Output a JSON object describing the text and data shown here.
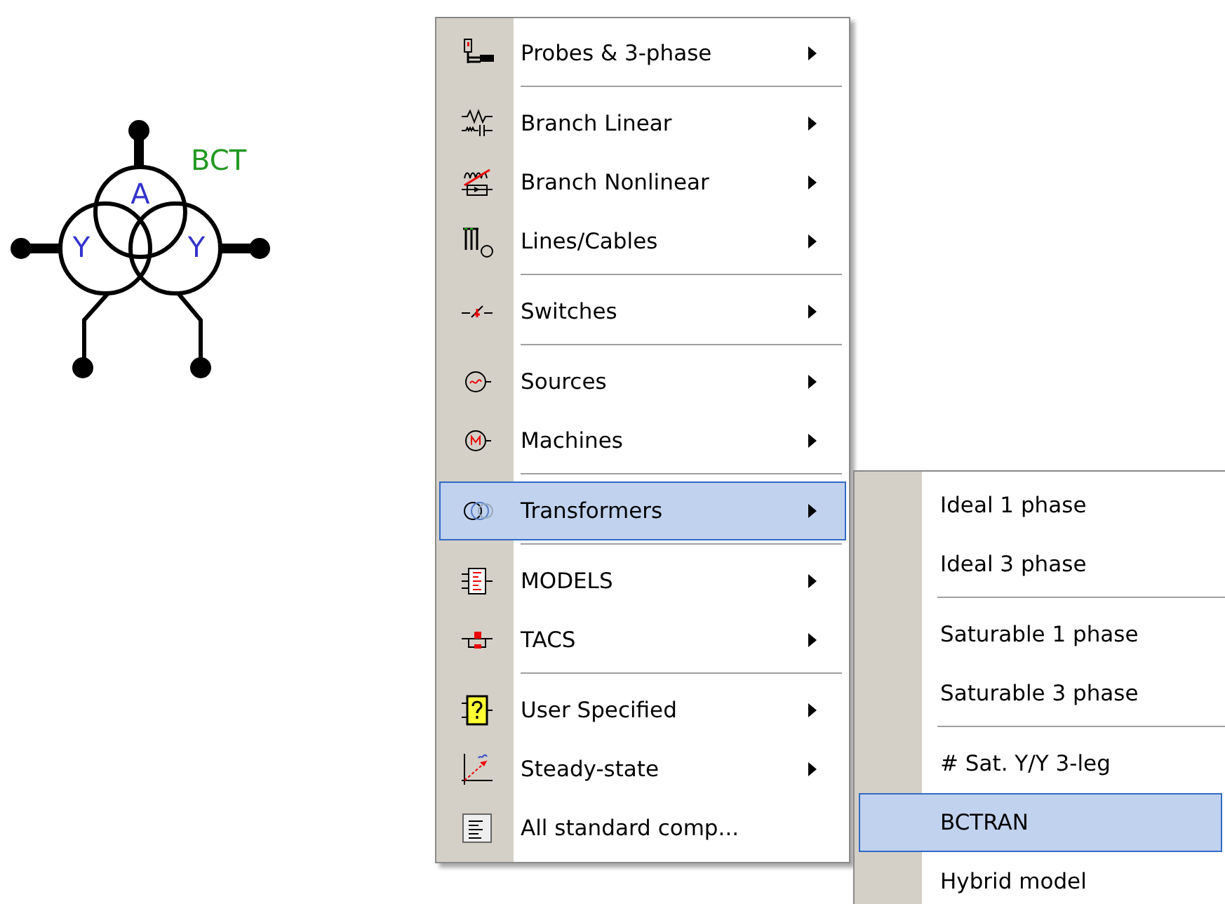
{
  "symbol": {
    "label": "BCT",
    "windings": [
      "A",
      "Y",
      "Y"
    ]
  },
  "menu": {
    "items": [
      {
        "kind": "item",
        "label": "Probes & 3-phase",
        "submenu": true,
        "selected": false
      },
      {
        "kind": "separator"
      },
      {
        "kind": "item",
        "label": "Branch Linear",
        "submenu": true,
        "selected": false
      },
      {
        "kind": "item",
        "label": "Branch Nonlinear",
        "submenu": true,
        "selected": false
      },
      {
        "kind": "item",
        "label": "Lines/Cables",
        "submenu": true,
        "selected": false
      },
      {
        "kind": "separator"
      },
      {
        "kind": "item",
        "label": "Switches",
        "submenu": true,
        "selected": false
      },
      {
        "kind": "separator"
      },
      {
        "kind": "item",
        "label": "Sources",
        "submenu": true,
        "selected": false
      },
      {
        "kind": "item",
        "label": "Machines",
        "submenu": true,
        "selected": false
      },
      {
        "kind": "separator"
      },
      {
        "kind": "item",
        "label": "Transformers",
        "submenu": true,
        "selected": true
      },
      {
        "kind": "separator"
      },
      {
        "kind": "item",
        "label": "MODELS",
        "submenu": true,
        "selected": false
      },
      {
        "kind": "item",
        "label": "TACS",
        "submenu": true,
        "selected": false
      },
      {
        "kind": "separator"
      },
      {
        "kind": "item",
        "label": "User Specified",
        "submenu": true,
        "selected": false
      },
      {
        "kind": "item",
        "label": "Steady-state",
        "submenu": true,
        "selected": false
      },
      {
        "kind": "item",
        "label": "All standard comp...",
        "submenu": false,
        "selected": false
      }
    ]
  },
  "submenu": {
    "items": [
      {
        "kind": "item",
        "label": "Ideal 1 phase",
        "selected": false
      },
      {
        "kind": "item",
        "label": "Ideal 3 phase",
        "selected": false
      },
      {
        "kind": "separator"
      },
      {
        "kind": "item",
        "label": "Saturable 1 phase",
        "selected": false
      },
      {
        "kind": "item",
        "label": "Saturable 3 phase",
        "selected": false
      },
      {
        "kind": "separator"
      },
      {
        "kind": "item",
        "label": "# Sat. Y/Y 3-leg",
        "selected": false
      },
      {
        "kind": "item",
        "label": "BCTRAN",
        "selected": true
      },
      {
        "kind": "item",
        "label": "Hybrid model",
        "selected": false
      }
    ]
  }
}
